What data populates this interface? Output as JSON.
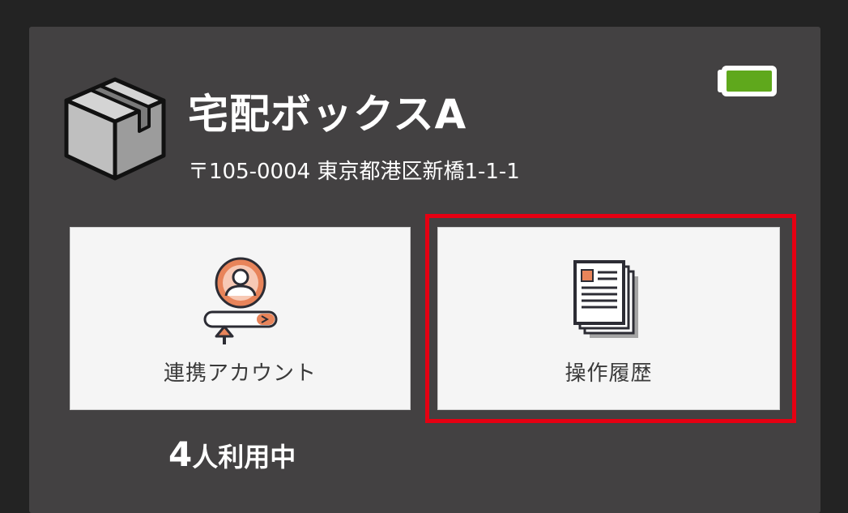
{
  "device": {
    "name": "宅配ボックスA",
    "address": "〒105-0004 東京都港区新橋1-1-1",
    "battery_level": 1.0
  },
  "cards": [
    {
      "label": "連携アカウント",
      "icon": "account-link-icon"
    },
    {
      "label": "操作履歴",
      "icon": "history-document-icon"
    }
  ],
  "usage": {
    "count": "4",
    "suffix": "人利用中"
  },
  "colors": {
    "background": "#232323",
    "panel": "#434142",
    "card": "#f5f5f5",
    "highlight": "#e60012",
    "battery": "#5fa81c",
    "accent": "#e8845a"
  }
}
